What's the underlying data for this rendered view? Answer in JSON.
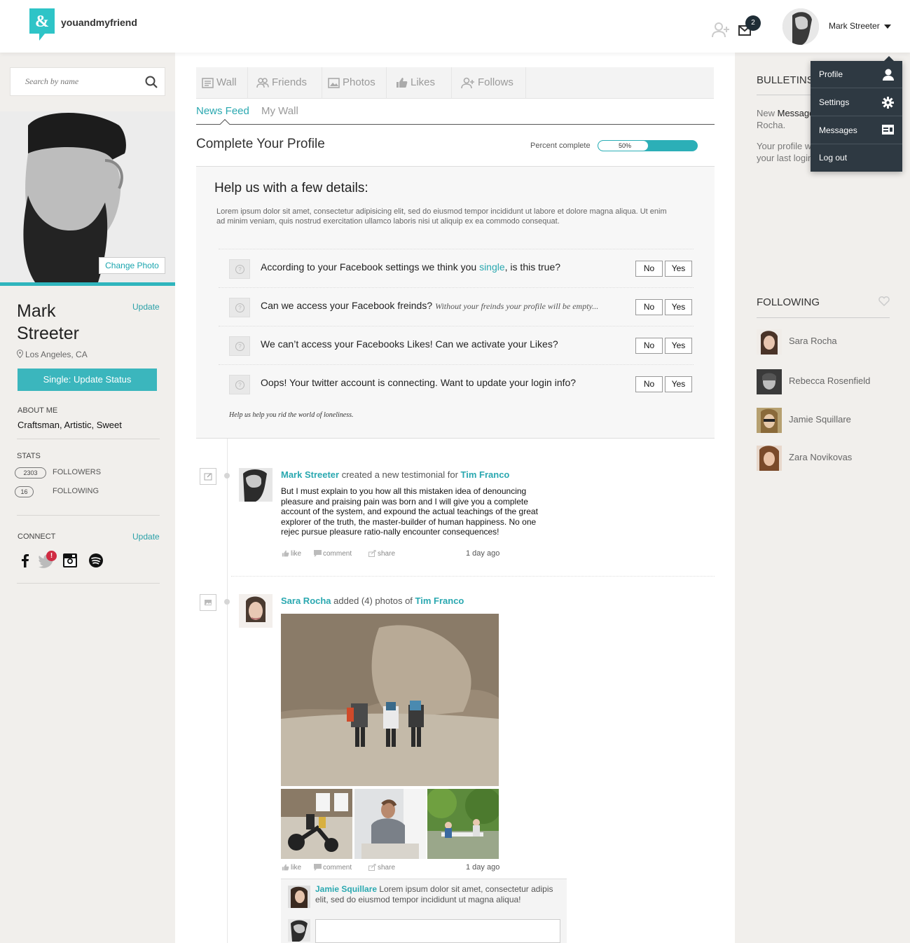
{
  "header": {
    "brand": "youandmyfriend",
    "mail_count": "2",
    "user_name": "Mark Streeter"
  },
  "user_menu": {
    "items": [
      {
        "label": "Profile",
        "icon": "user-icon"
      },
      {
        "label": "Settings",
        "icon": "gear-icon"
      },
      {
        "label": "Messages",
        "icon": "message-card-icon"
      },
      {
        "label": "Log out"
      }
    ]
  },
  "sidebar": {
    "search_placeholder": "Search by name",
    "change_photo": "Change Photo",
    "first_name": "Mark",
    "last_name": "Streeter",
    "update_label": "Update",
    "location": "Los Angeles, CA",
    "status_button": "Single: Update Status",
    "about_label": "ABOUT ME",
    "about_value": "Craftsman, Artistic, Sweet",
    "stats_label": "STATS",
    "followers_count": "2303",
    "followers_label": "FOLLOWERS",
    "following_count": "16",
    "following_label": "FOLLOWING",
    "connect_label": "CONNECT",
    "connect_update": "Update",
    "twitter_badge": "!",
    "social_icons": [
      "facebook-icon",
      "twitter-icon",
      "instagram-icon",
      "spotify-icon"
    ]
  },
  "tabs": [
    {
      "label": "Wall",
      "icon": "wall-icon"
    },
    {
      "label": "Friends",
      "icon": "friends-icon"
    },
    {
      "label": "Photos",
      "icon": "photo-icon"
    },
    {
      "label": "Likes",
      "icon": "thumbs-up-icon"
    },
    {
      "label": "Follows",
      "icon": "add-user-icon"
    }
  ],
  "subtabs": {
    "active": "News Feed",
    "other": "My Wall"
  },
  "profile_completion": {
    "title": "Complete Your Profile",
    "percent_label": "Percent complete",
    "percent_text": "50%",
    "percent_value": 0.5,
    "help_title": "Help us with a few details:",
    "help_desc": "Lorem ipsum dolor sit amet, consectetur adipisicing elit, sed do eiusmod tempor incididunt ut labore et dolore magna aliqua. Ut enim ad minim veniam, quis nostrud exercitation ullamco laboris nisi ut aliquip ex ea commodo consequat.",
    "questions": [
      {
        "pre": "According to your Facebook settings we think you ",
        "highlight": "single",
        "post": ", is this true?",
        "note": ""
      },
      {
        "pre": "Can we access your Facebook freinds?",
        "highlight": "",
        "post": "",
        "note": "Without your freinds your profile will be empty..."
      },
      {
        "pre": "We can’t access your Facebooks Likes! Can we activate your Likes?",
        "highlight": "",
        "post": "",
        "note": ""
      },
      {
        "pre": "Oops! Your twitter account is connecting. Want to update your login info?",
        "highlight": "",
        "post": "",
        "note": ""
      }
    ],
    "no_label": "No",
    "yes_label": "Yes",
    "footer": "Help us help you rid the world of loneliness."
  },
  "feed": {
    "post1": {
      "author": "Mark Streeter",
      "action": " created a new testimonial for ",
      "target": "Tim Franco",
      "body": "But I must explain to you how all this mistaken idea of denouncing pleasure and praising pain was born and I will give you a complete account of the system, and expound the actual teachings of the great explorer of the truth, the master-builder of human happiness. No one rejec pursue pleasure ratio-nally encounter consequences!",
      "like": "like",
      "comment": "comment",
      "share": "share",
      "time": "1 day ago"
    },
    "post2": {
      "author": "Sara Rocha",
      "action": " added (4) photos of ",
      "target": "Tim Franco",
      "like": "like",
      "comment": "comment",
      "share": "share",
      "time": "1 day ago",
      "comment_author": "Jamie Squillare",
      "comment_text": " Lorem ipsum dolor sit amet, consectetur adipis elit, sed do eiusmod tempor incididunt ut magna aliqua!"
    }
  },
  "bulletins": {
    "title": "BULLETINS",
    "item1_pre": "New ",
    "item1_bold": "Message",
    "item1_post": " from Sara Rocha.",
    "item2": "Your profile was updated since your last login."
  },
  "following": {
    "title": "FOLLOWING",
    "people": [
      "Sara Rocha",
      "Rebecca Rosenfield",
      "Jamie Squillare",
      "Zara Novikovas"
    ]
  },
  "colors": {
    "accent": "#2cafb7",
    "dark": "#2e3942",
    "badge_red": "#d02b42"
  }
}
